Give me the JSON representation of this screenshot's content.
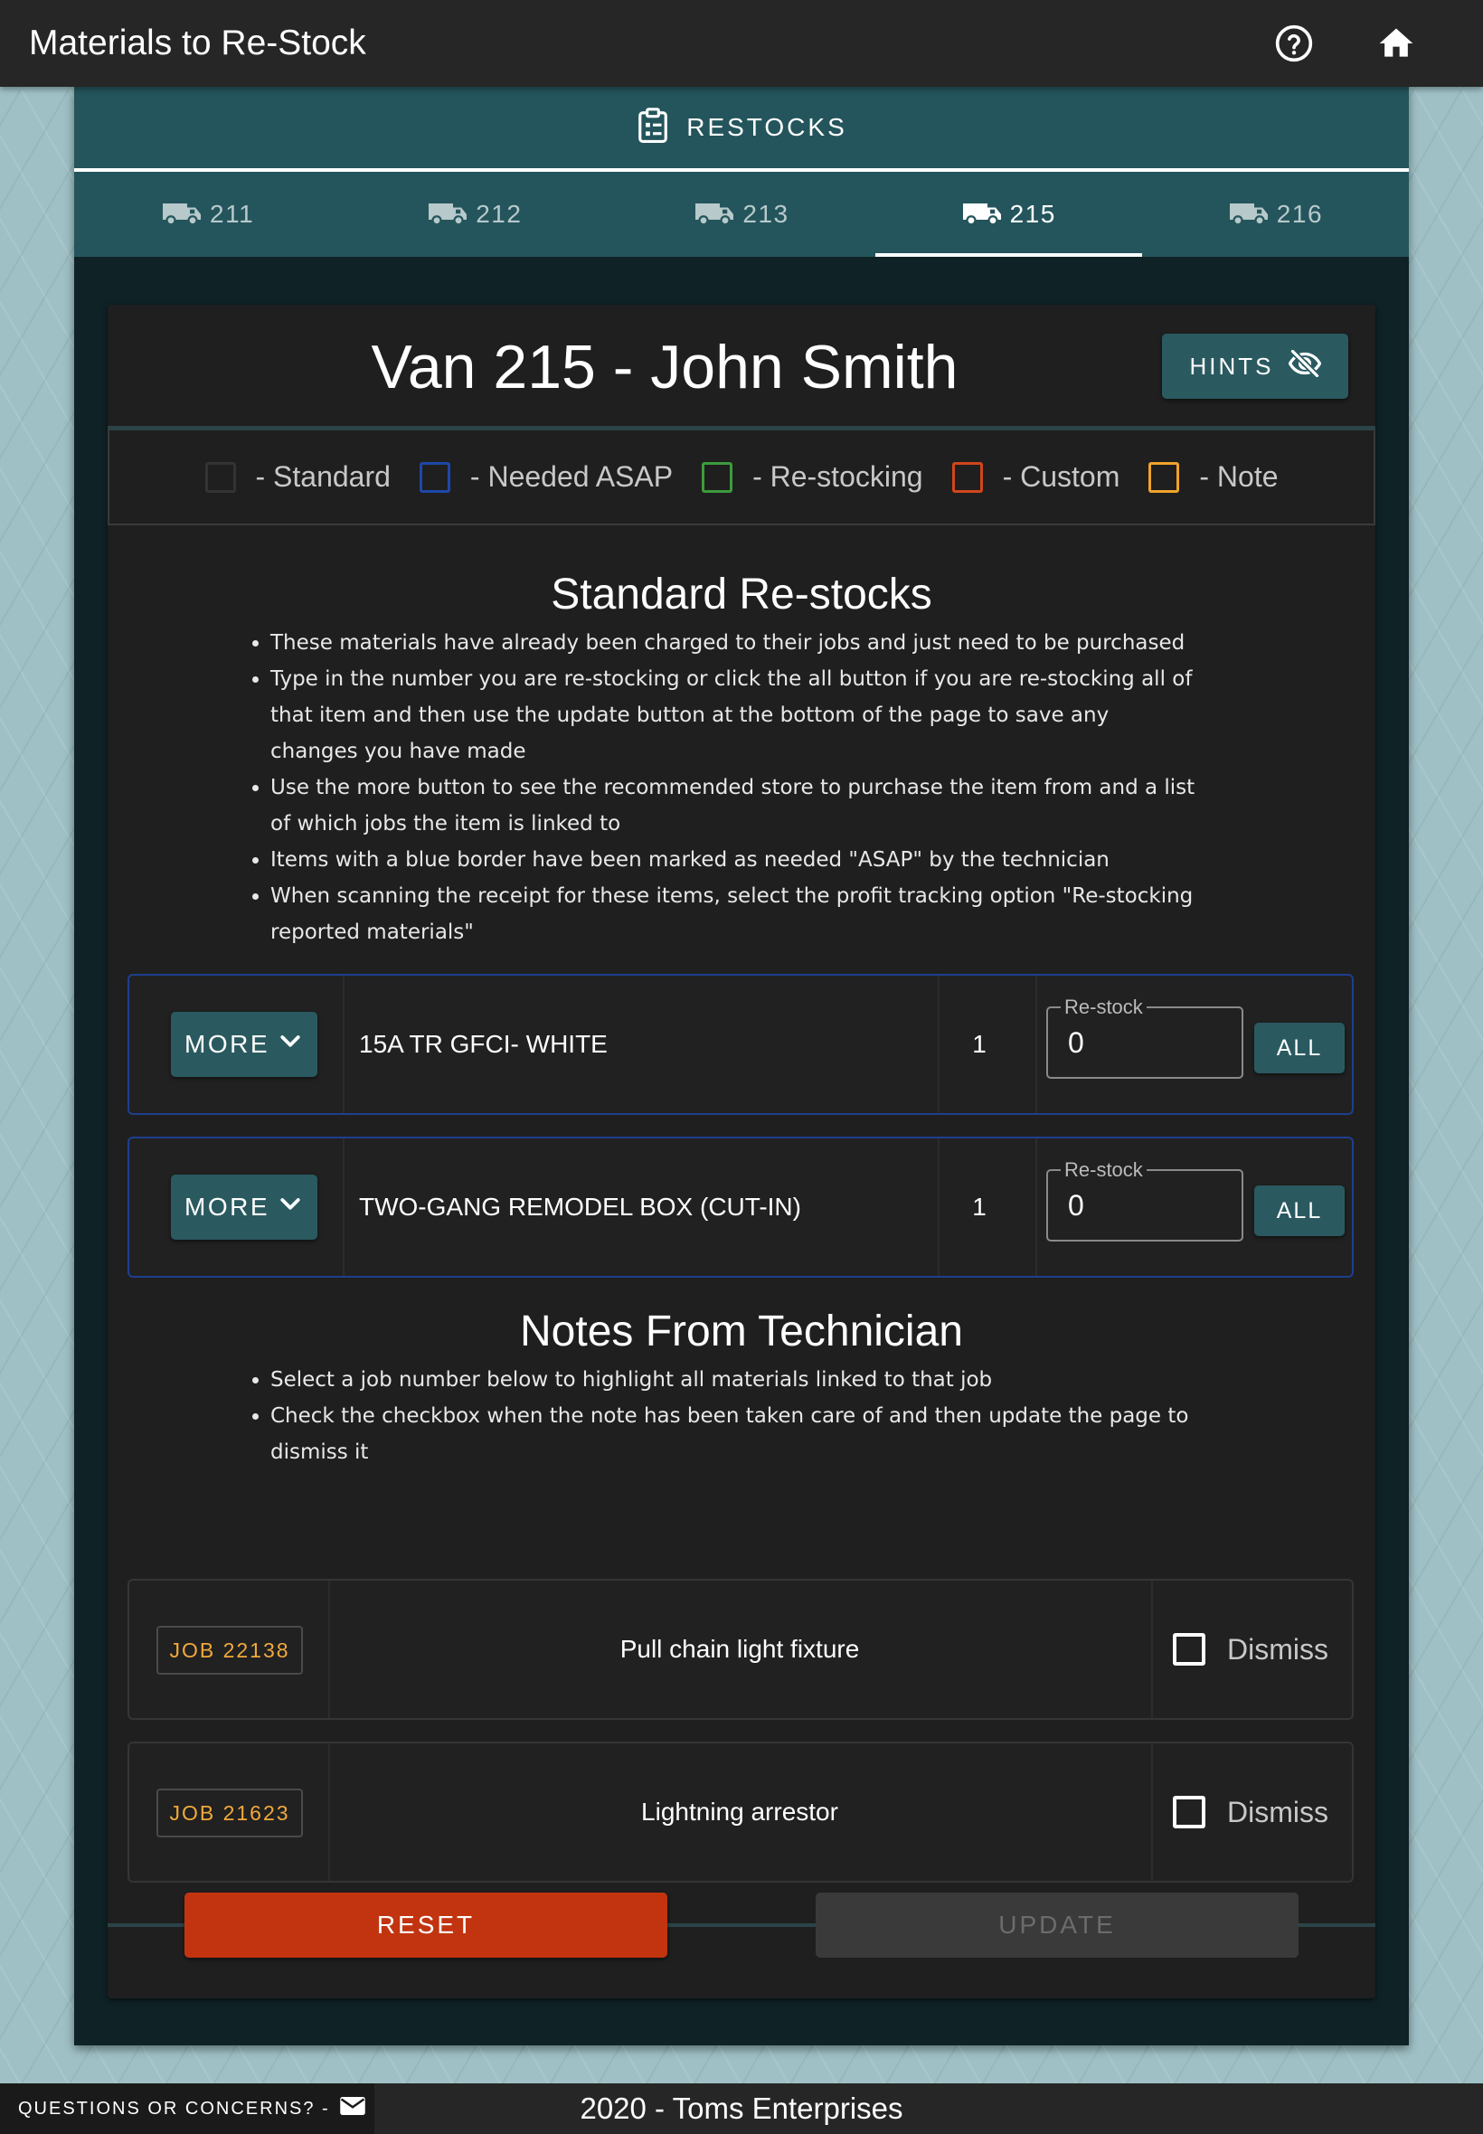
{
  "appbar": {
    "title": "Materials to Re-Stock",
    "help_icon": "help-circle-icon",
    "home_icon": "home-icon"
  },
  "panel": {
    "header_label": "RESTOCKS",
    "header_icon": "clipboard-list-icon",
    "tabs": [
      {
        "label": "211",
        "icon": "van-icon",
        "active": false
      },
      {
        "label": "212",
        "icon": "van-icon",
        "active": false
      },
      {
        "label": "213",
        "icon": "van-icon",
        "active": false
      },
      {
        "label": "215",
        "icon": "van-icon",
        "active": true
      },
      {
        "label": "216",
        "icon": "van-icon",
        "active": false
      }
    ]
  },
  "card": {
    "title": "Van 215 - John Smith",
    "hints_label": "HINTS",
    "hints_icon": "eye-off-icon"
  },
  "legend": [
    {
      "label": "- Standard",
      "color": "#333333"
    },
    {
      "label": "- Needed ASAP",
      "color": "#1e47a8"
    },
    {
      "label": "- Re-stocking",
      "color": "#3d9b3d"
    },
    {
      "label": "- Custom",
      "color": "#d0461c"
    },
    {
      "label": "- Note",
      "color": "#f0a32c"
    }
  ],
  "standard": {
    "title": "Standard Re-stocks",
    "bullets": [
      "These materials have already been charged to their jobs and just need to be purchased",
      "Type in the number you are re-stocking or click the all button if you are re-stocking all of that item and then use the update button at the bottom of the page to save any changes you have made",
      "Use the more button to see the recommended store to purchase the item from and a list of which jobs the item is linked to",
      "Items with a blue border have been marked as needed \"ASAP\" by the technician",
      "When scanning the receipt for these items, select the profit tracking option \"Re-stocking reported materials\""
    ],
    "items": [
      {
        "more_label": "MORE",
        "name": "15A TR GFCI- WHITE",
        "qty": "1",
        "restock_label": "Re-stock",
        "restock_value": "0",
        "all_label": "ALL"
      },
      {
        "more_label": "MORE",
        "name": "TWO-GANG REMODEL BOX (CUT-IN)",
        "qty": "1",
        "restock_label": "Re-stock",
        "restock_value": "0",
        "all_label": "ALL"
      }
    ]
  },
  "notes": {
    "title": "Notes From Technician",
    "bullets": [
      "Select a job number below to highlight all materials linked to that job",
      "Check the checkbox when the note has been taken care of and then update the page to dismiss it"
    ],
    "items": [
      {
        "job": "JOB 22138",
        "text": "Pull chain light fixture",
        "dismiss_label": "Dismiss",
        "checked": false
      },
      {
        "job": "JOB 21623",
        "text": "Lightning arrestor",
        "dismiss_label": "Dismiss",
        "checked": false
      }
    ]
  },
  "actions": {
    "reset_label": "RESET",
    "update_label": "UPDATE"
  },
  "footer": {
    "contact_label": "QUESTIONS OR CONCERNS? -",
    "contact_icon": "email-icon",
    "copyright": "2020 - Toms Enterprises"
  }
}
